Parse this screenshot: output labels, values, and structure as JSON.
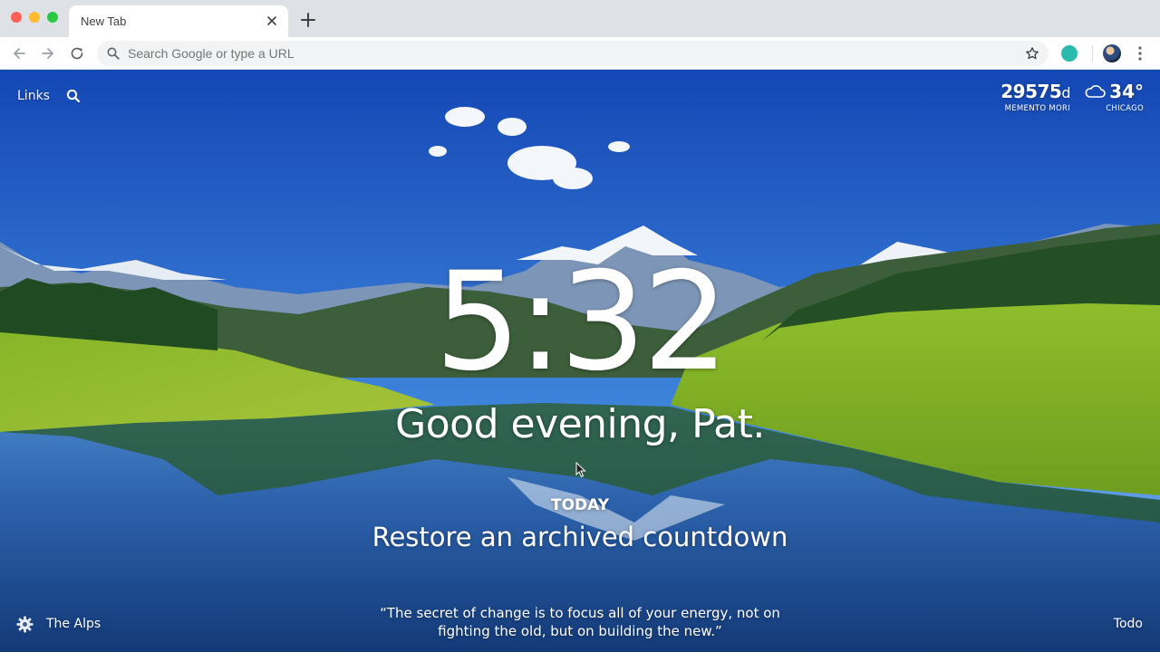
{
  "browser": {
    "tab_title": "New Tab",
    "omnibox_placeholder": "Search Google or type a URL",
    "extension_color": "#2bbbad"
  },
  "dashboard": {
    "links_label": "Links",
    "memento": {
      "value": "29575",
      "unit": "d",
      "label": "MEMENTO MORI"
    },
    "weather": {
      "temp": "34°",
      "city": "CHICAGO",
      "icon": "cloud-icon"
    },
    "clock": "5:32",
    "greeting": "Good evening, Pat.",
    "focus": {
      "heading": "TODAY",
      "text": "Restore an archived countdown"
    },
    "photo_location": "The Alps",
    "quote": "“The secret of change is to focus all of your energy, not on fighting the old, but on building the new.”",
    "todo_label": "Todo"
  },
  "colors": {
    "sky_top": "#1a56c4",
    "sky_bottom": "#7fb3ea",
    "grass": "#8dbb2c",
    "lake": "#1f4f9a"
  }
}
